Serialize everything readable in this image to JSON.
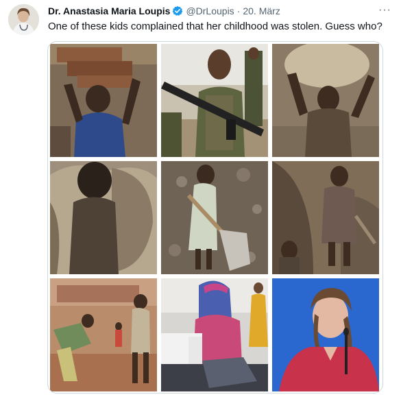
{
  "tweet": {
    "author_name": "Dr. Anastasia Maria Loupis",
    "handle": "@DrLoupis",
    "separator": "·",
    "date": "20. März",
    "more_label": "···",
    "text": "One of these kids complained that her childhood was stolen. Guess who?"
  },
  "icons": {
    "verified": "verified-badge-icon",
    "more": "more-options-icon"
  },
  "colors": {
    "verified_blue": "#1d9bf0",
    "secondary_text": "#536471",
    "primary_text": "#0f1419"
  },
  "images": [
    "child-carrying-bricks",
    "child-soldier-with-rifle",
    "child-carrying-load-on-head",
    "child-carrying-sack",
    "girl-with-shovel",
    "boy-in-mine",
    "children-brick-kiln",
    "girl-at-sewing-machine",
    "girl-speaking"
  ]
}
